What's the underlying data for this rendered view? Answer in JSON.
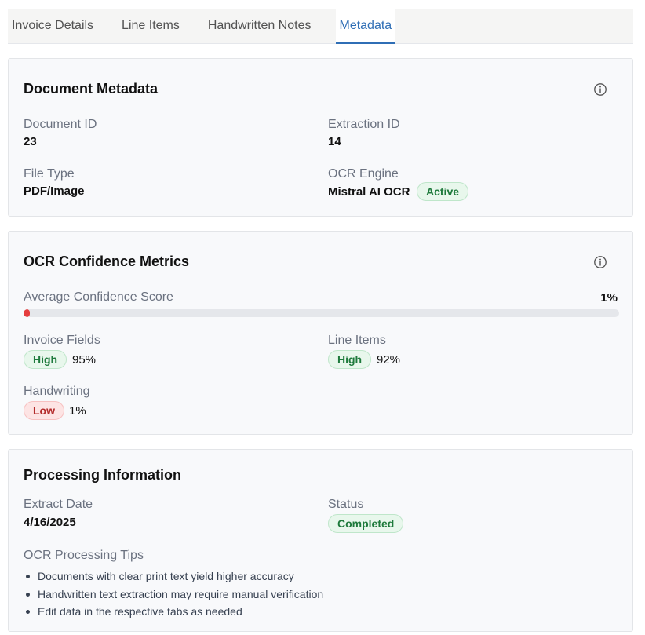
{
  "tabs": [
    {
      "label": "Invoice Details",
      "active": false
    },
    {
      "label": "Line Items",
      "active": false
    },
    {
      "label": "Handwritten Notes",
      "active": false
    },
    {
      "label": "Metadata",
      "active": true
    }
  ],
  "document_metadata": {
    "title": "Document Metadata",
    "icon": "info-icon",
    "document_id_label": "Document ID",
    "document_id": "23",
    "extraction_id_label": "Extraction ID",
    "extraction_id": "14",
    "file_type_label": "File Type",
    "file_type": "PDF/Image",
    "ocr_engine_label": "OCR Engine",
    "ocr_engine": "Mistral AI OCR",
    "ocr_engine_status": "Active"
  },
  "ocr_confidence": {
    "title": "OCR Confidence Metrics",
    "icon": "info-icon",
    "average_label": "Average Confidence Score",
    "average_value": "1%",
    "average_fraction": 0.01,
    "invoice_fields_label": "Invoice Fields",
    "invoice_fields_level": "High",
    "invoice_fields_value": "95%",
    "line_items_label": "Line Items",
    "line_items_level": "High",
    "line_items_value": "92%",
    "handwriting_label": "Handwriting",
    "handwriting_level": "Low",
    "handwriting_value": "1%"
  },
  "processing": {
    "title": "Processing Information",
    "extract_date_label": "Extract Date",
    "extract_date": "4/16/2025",
    "status_label": "Status",
    "status": "Completed",
    "tips_title": "OCR Processing Tips",
    "tips": [
      "Documents with clear print text yield higher accuracy",
      "Handwritten text extraction may require manual verification",
      "Edit data in the respective tabs as needed"
    ]
  },
  "colors": {
    "accent": "#2f6eb5",
    "success": "#1e7a3c",
    "danger": "#e53e3e"
  }
}
